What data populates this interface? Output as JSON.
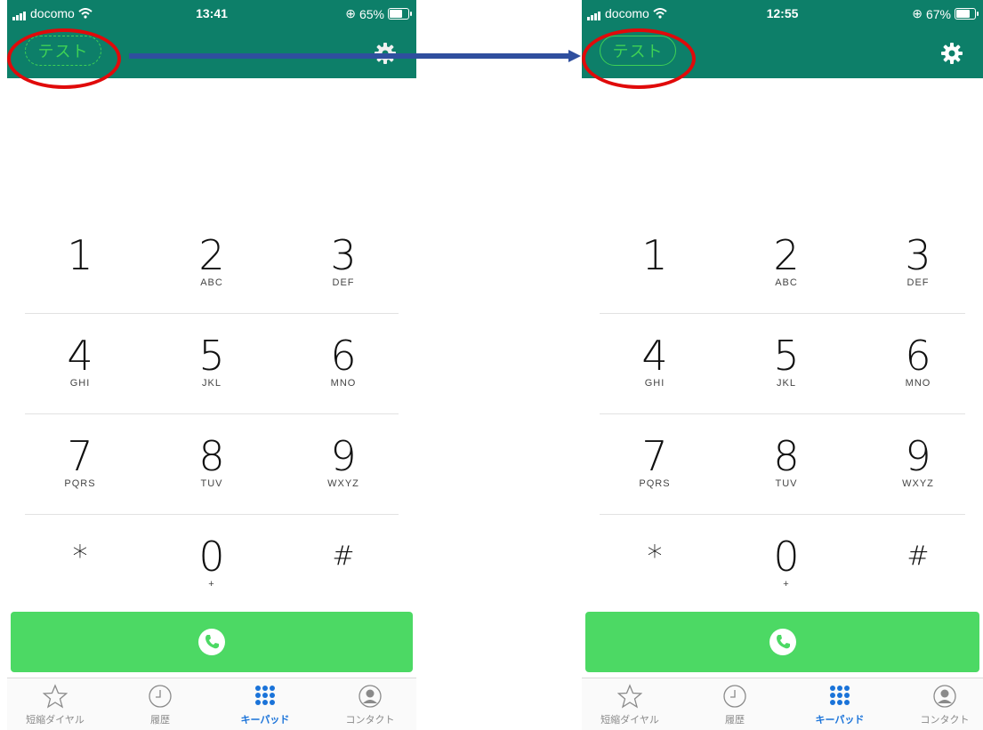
{
  "phones": [
    {
      "status": {
        "carrier": "docomo",
        "time": "13:41",
        "battery_text": "65%",
        "battery_level": 0.65
      },
      "header": {
        "test_label": "テスト",
        "test_style": "dashed"
      }
    },
    {
      "status": {
        "carrier": "docomo",
        "time": "12:55",
        "battery_text": "67%",
        "battery_level": 0.67
      },
      "header": {
        "test_label": "テスト",
        "test_style": "solid"
      }
    }
  ],
  "keypad": [
    [
      {
        "digit": "1",
        "letters": ""
      },
      {
        "digit": "2",
        "letters": "ABC"
      },
      {
        "digit": "3",
        "letters": "DEF"
      }
    ],
    [
      {
        "digit": "4",
        "letters": "GHI"
      },
      {
        "digit": "5",
        "letters": "JKL"
      },
      {
        "digit": "6",
        "letters": "MNO"
      }
    ],
    [
      {
        "digit": "7",
        "letters": "PQRS"
      },
      {
        "digit": "8",
        "letters": "TUV"
      },
      {
        "digit": "9",
        "letters": "WXYZ"
      }
    ],
    [
      {
        "digit": "*",
        "letters": ""
      },
      {
        "digit": "0",
        "letters": "+"
      },
      {
        "digit": "#",
        "letters": ""
      }
    ]
  ],
  "tabs": [
    {
      "label": "短縮ダイヤル",
      "icon": "star-icon",
      "active": false
    },
    {
      "label": "履歴",
      "icon": "clock-icon",
      "active": false
    },
    {
      "label": "キーパッド",
      "icon": "keypad-icon",
      "active": true
    },
    {
      "label": "コンタクト",
      "icon": "contact-icon",
      "active": false
    }
  ],
  "colors": {
    "header": "#0d7f69",
    "accent_green": "#3ed155",
    "call_green": "#4cd964",
    "highlight_red": "#e00a0a",
    "arrow_blue": "#2f4f9e",
    "active_tab": "#1a73d9"
  }
}
